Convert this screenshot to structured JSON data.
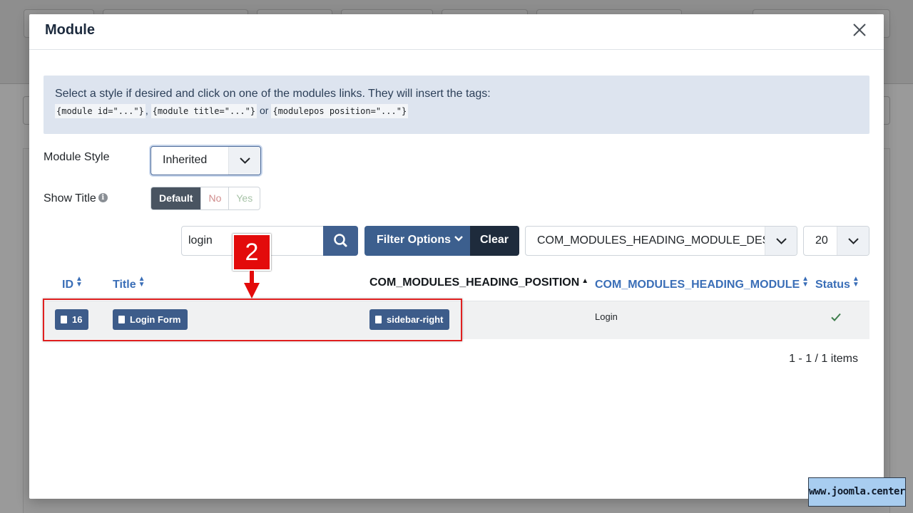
{
  "modal": {
    "title": "Module"
  },
  "info": {
    "text": "Select a style if desired and click on one of the modules links. They will insert the tags:",
    "code_module_id": "{module id=\"...\"}",
    "sep1": ",",
    "code_module_title": "{module title=\"...\"}",
    "sep2": "or",
    "code_modulepos": "{modulepos position=\"...\"}"
  },
  "module_style": {
    "label": "Module Style",
    "value": "Inherited"
  },
  "show_title": {
    "label": "Show Title",
    "options": [
      "Default",
      "No",
      "Yes"
    ],
    "selected": "Default"
  },
  "filters": {
    "search_value": "login",
    "filter_options_label": "Filter Options",
    "clear_label": "Clear",
    "ordering_value": "COM_MODULES_HEADING_MODULE_DESC",
    "limit_value": "20"
  },
  "table": {
    "headers": {
      "id": "ID",
      "title": "Title",
      "position": "COM_MODULES_HEADING_POSITION",
      "module": "COM_MODULES_HEADING_MODULE",
      "status": "Status"
    },
    "rows": [
      {
        "id": "16",
        "title": "Login Form",
        "position": "sidebar-right",
        "module": "Login",
        "status": "published"
      }
    ]
  },
  "pagination": "1 - 1 / 1 items",
  "annotation": {
    "step": "2",
    "color": "#e30b0b"
  },
  "watermark": "www.joomla.center"
}
